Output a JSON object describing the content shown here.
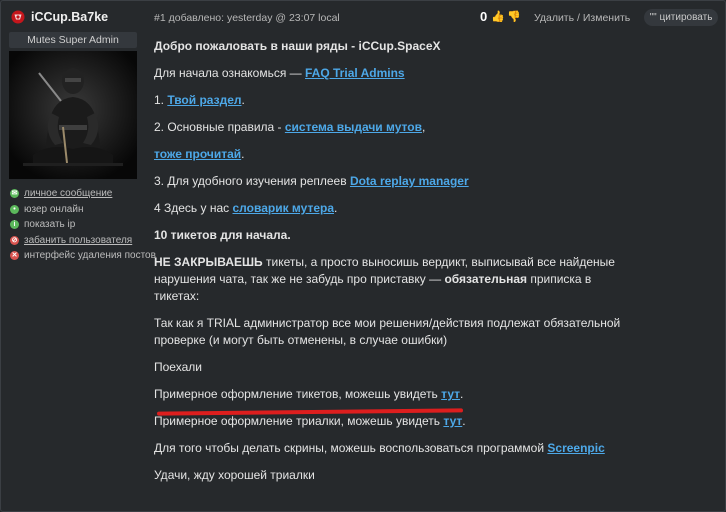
{
  "author": {
    "name": "iCCup.Ba7ke",
    "role": "Mutes Super Admin"
  },
  "sidebar_actions": [
    {
      "label": "личное сообщение",
      "icon": "message-icon",
      "color": "#5cb85c",
      "link": true
    },
    {
      "label": "юзер онлайн",
      "icon": "online-icon",
      "color": "#5cb85c",
      "link": false
    },
    {
      "label": "показать ip",
      "icon": "ip-icon",
      "color": "#5cb85c",
      "link": false
    },
    {
      "label": "забанить пользователя",
      "icon": "ban-icon",
      "color": "#d9534f",
      "link": true
    },
    {
      "label": "интерфейс удаления постов",
      "icon": "delete-icon",
      "color": "#d9534f",
      "link": false
    }
  ],
  "header": {
    "meta": "#1 добавлено: yesterday @ 23:07 local",
    "rating": "0",
    "delete_label": "Удалить",
    "separator": "/",
    "edit_label": "Изменить",
    "quote_label": "цитировать",
    "quote_icon": "\"\""
  },
  "content": {
    "greeting": "Добро пожаловать в наши ряды - iCCup.SpaceX",
    "intro_prefix": "Для начала ознакомься — ",
    "intro_link": "FAQ Trial Admins",
    "item1_prefix": "1. ",
    "item1_link": "Твой раздел",
    "item1_suffix": ".",
    "item2_prefix": "2. Основные правила - ",
    "item2_link": "система выдачи мутов",
    "item2_suffix": ",",
    "item2b_link": "тоже прочитай",
    "item2b_suffix": ".",
    "item3_prefix": "3. Для удобного изучения реплеев ",
    "item3_link": "Dota replay manager",
    "item4_prefix": "4 Здесь у нас ",
    "item4_link": "словарик мутера",
    "item4_suffix": ".",
    "tickets": "10 тикетов для начала.",
    "rule_bold": "НЕ ЗАКРЫВАЕШЬ",
    "rule_text": " тикеты, а просто выносишь вердикт, выписывай все найденые нарушения чата, так же не забудь про приставку — ",
    "rule_bold2": "обязательная",
    "rule_text2": " приписка в тикетах:",
    "trial_note": "Так как я TRIAL администратор все мои решения/действия подлежат обязательной проверке (и могут быть отменены, в случае ошибки)",
    "go": "Поехали",
    "example1_prefix": "Примерное оформление тикетов, можешь увидеть ",
    "example1_link": "тут",
    "example1_suffix": ".",
    "example2_prefix": "Примерное оформление триалки, можешь увидеть ",
    "example2_link": "тут",
    "example2_suffix": ".",
    "screens_prefix": "Для того чтобы делать скрины, можешь воспользоваться программой ",
    "screens_link": "Screenpic",
    "farewell": "Удачи, жду хорошей триалки"
  },
  "colors": {
    "link": "#4da8e8",
    "annotation": "#dd1e1e",
    "background": "#26292c"
  }
}
